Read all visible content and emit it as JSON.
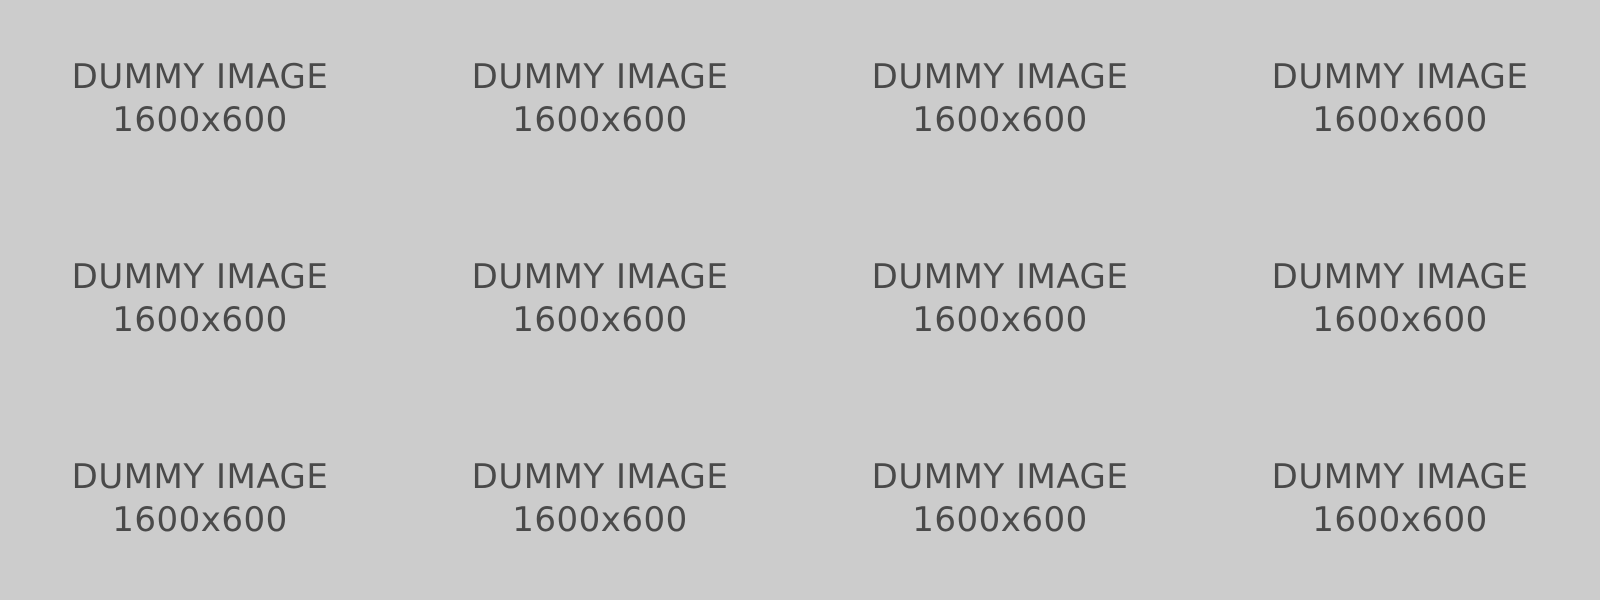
{
  "placeholder": {
    "line1": "DUMMY IMAGE",
    "line2": "1600x600",
    "background_color": "#cccccc",
    "text_color": "#4a4a4a"
  }
}
